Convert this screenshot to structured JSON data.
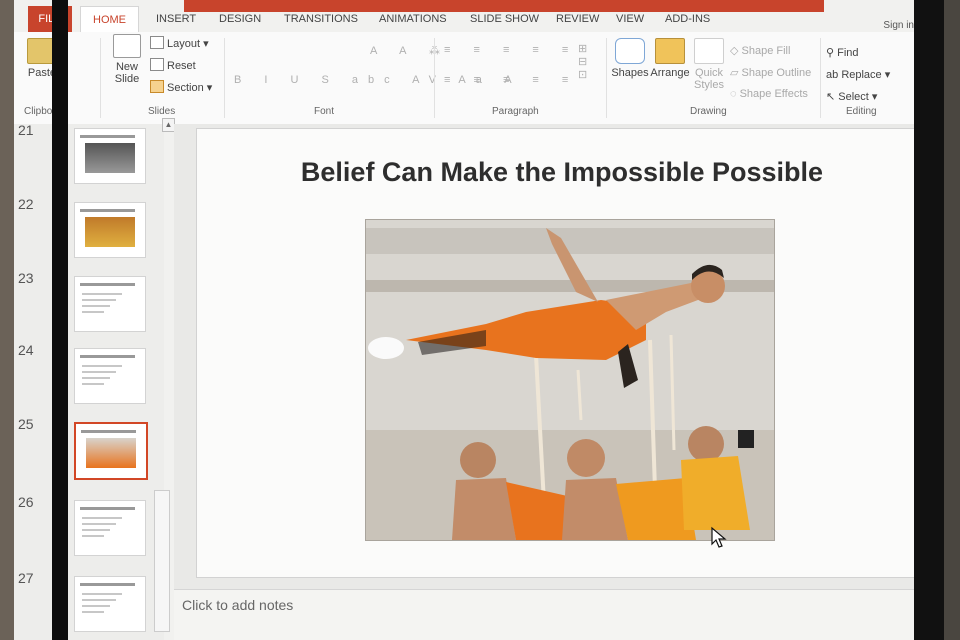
{
  "ribbon": {
    "tabs": [
      "FILE",
      "HOME",
      "INSERT",
      "DESIGN",
      "TRANSITIONS",
      "ANIMATIONS",
      "SLIDE SHOW",
      "REVIEW",
      "VIEW",
      "ADD-INS"
    ],
    "sign_in": "Sign in",
    "clipboard": {
      "paste": "Paste",
      "group": "Clipboard"
    },
    "slides": {
      "new_slide": "New Slide",
      "layout": "Layout",
      "reset": "Reset",
      "section": "Section",
      "group": "Slides"
    },
    "font": {
      "group": "Font"
    },
    "paragraph": {
      "group": "Paragraph"
    },
    "drawing": {
      "shapes": "Shapes",
      "arrange": "Arrange",
      "quick_styles": "Quick Styles",
      "shape_fill": "Shape Fill",
      "shape_outline": "Shape Outline",
      "shape_effects": "Shape Effects",
      "group": "Drawing"
    },
    "editing": {
      "find": "Find",
      "replace": "Replace",
      "select": "Select",
      "group": "Editing"
    }
  },
  "thumbnails": [
    {
      "number": "21",
      "selected": false
    },
    {
      "number": "22",
      "selected": false
    },
    {
      "number": "23",
      "selected": false
    },
    {
      "number": "24",
      "selected": false
    },
    {
      "number": "25",
      "selected": true
    },
    {
      "number": "26",
      "selected": false
    },
    {
      "number": "27",
      "selected": false
    }
  ],
  "slide": {
    "title": "Belief Can Make the Impossible Possible",
    "image": "photo of a monk in orange robes held aloft on spear tips by other monks"
  },
  "notes_placeholder": "Click to add notes",
  "colors": {
    "accent": "#d24726",
    "robe": "#e8731e"
  }
}
